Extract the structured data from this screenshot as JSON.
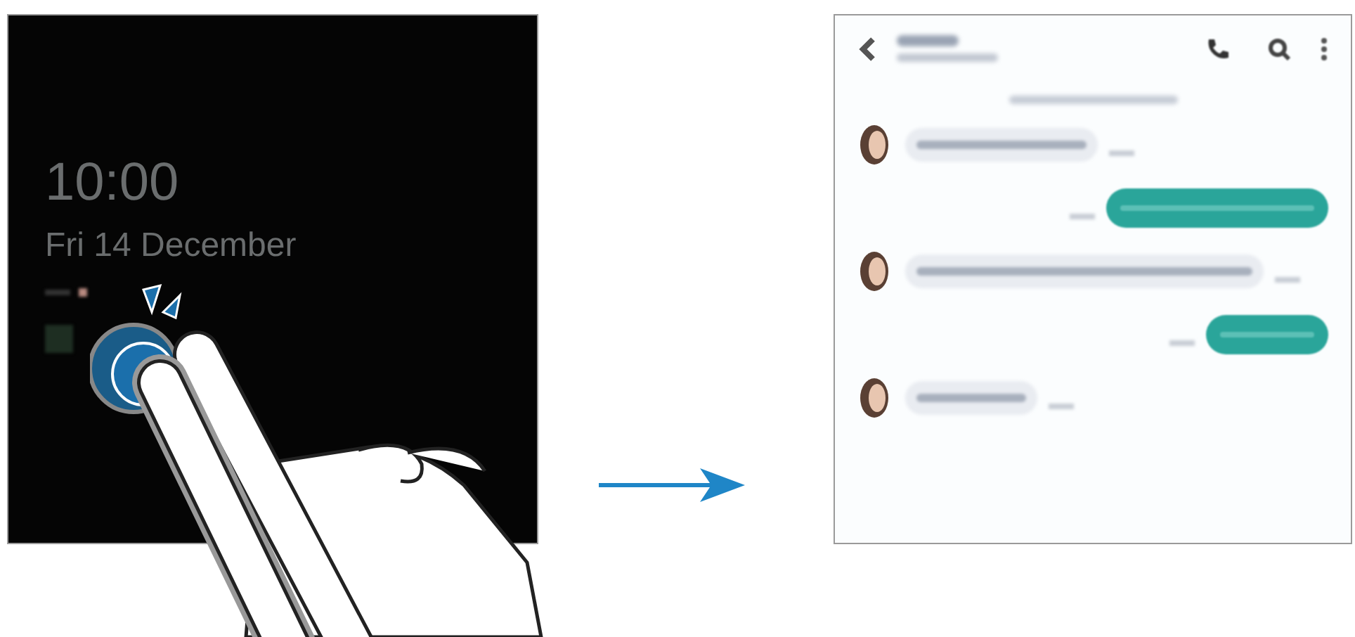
{
  "lock_screen": {
    "time": "10:00",
    "date": "Fri 14 December"
  },
  "chat_screen": {
    "messages": [
      {
        "kind": "received"
      },
      {
        "kind": "sent"
      },
      {
        "kind": "received"
      },
      {
        "kind": "sent"
      },
      {
        "kind": "received"
      }
    ]
  }
}
